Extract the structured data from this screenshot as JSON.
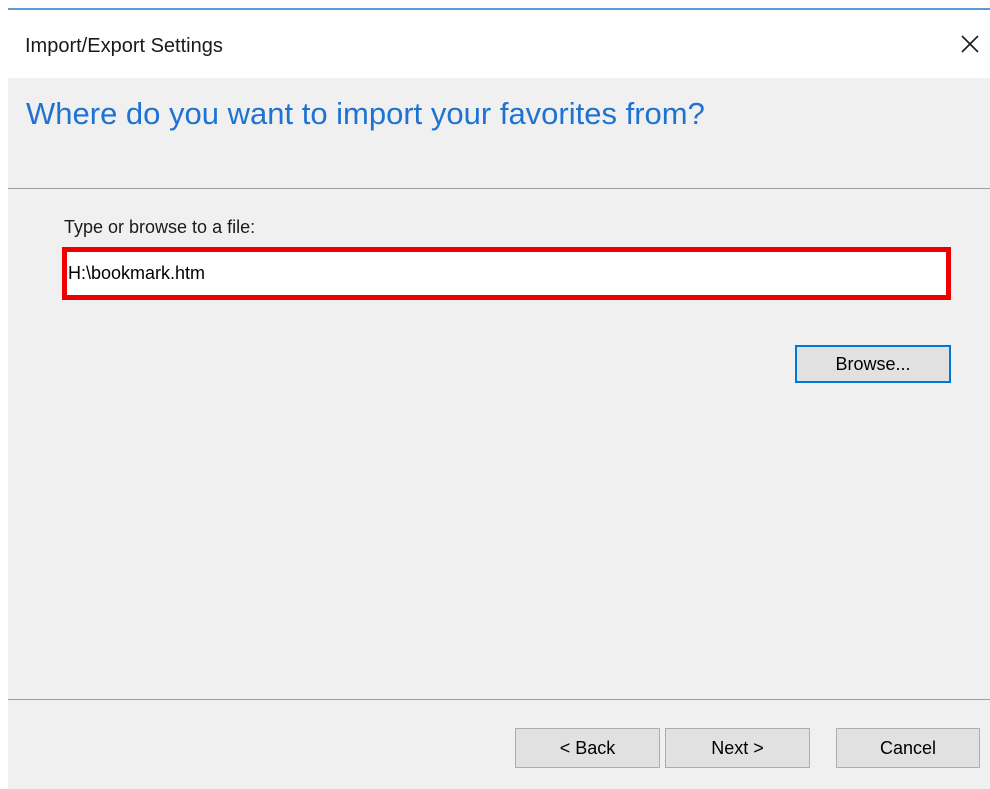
{
  "window": {
    "title": "Import/Export Settings",
    "close_icon": "close-icon"
  },
  "header": {
    "heading": "Where do you want to import your favorites from?"
  },
  "file_section": {
    "label": "Type or browse to a file:",
    "value": "H:\\bookmark.htm",
    "browse_label": "Browse..."
  },
  "footer": {
    "back_label": "< Back",
    "next_label": "Next >",
    "cancel_label": "Cancel"
  },
  "colors": {
    "heading_blue": "#1e73d2",
    "highlight_red": "#ee0000",
    "focus_blue": "#0078d7",
    "dialog_bg": "#f0f0f0"
  }
}
